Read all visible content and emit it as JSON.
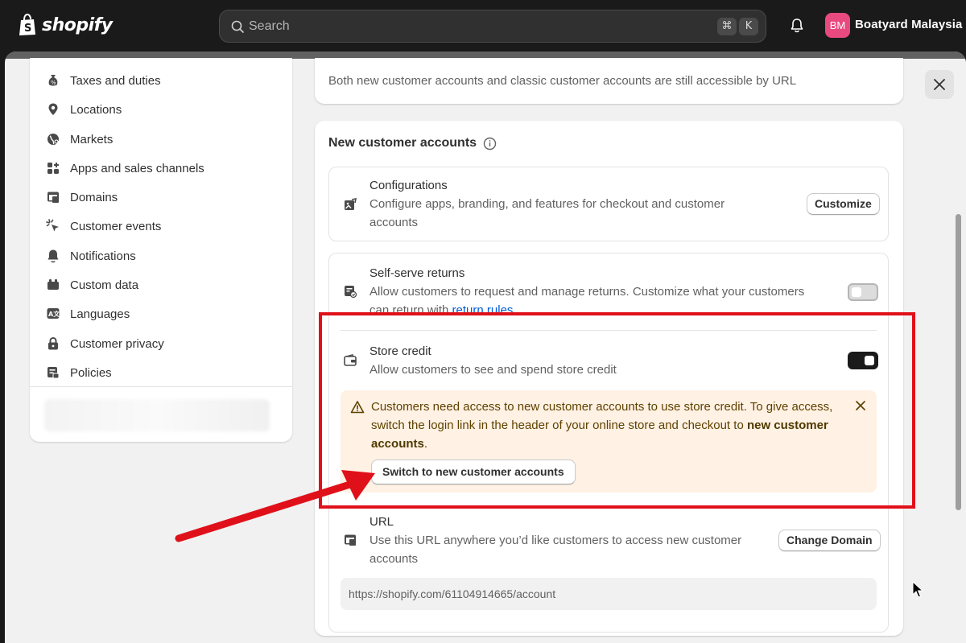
{
  "topbar": {
    "logo_text": "shopify",
    "search_placeholder": "Search",
    "kbd_cmd": "⌘",
    "kbd_k": "K",
    "avatar_initials": "BM",
    "store_name": "Boatyard Malaysia"
  },
  "sidebar": {
    "items": [
      {
        "label": "Taxes and duties",
        "icon": "taxes-icon"
      },
      {
        "label": "Locations",
        "icon": "location-pin-icon"
      },
      {
        "label": "Markets",
        "icon": "globe-icon"
      },
      {
        "label": "Apps and sales channels",
        "icon": "apps-icon"
      },
      {
        "label": "Domains",
        "icon": "domains-icon"
      },
      {
        "label": "Customer events",
        "icon": "cursor-click-icon"
      },
      {
        "label": "Notifications",
        "icon": "bell-icon"
      },
      {
        "label": "Custom data",
        "icon": "custom-data-icon"
      },
      {
        "label": "Languages",
        "icon": "language-icon"
      },
      {
        "label": "Customer privacy",
        "icon": "lock-icon"
      },
      {
        "label": "Policies",
        "icon": "policy-icon"
      }
    ]
  },
  "main": {
    "top_card_text": "Both new customer accounts and classic customer accounts are still accessible by URL",
    "section_title": "New customer accounts",
    "configurations": {
      "title": "Configurations",
      "desc_line1": "Configure apps, branding, and features for checkout and customer",
      "desc_line2": "accounts",
      "button": "Customize"
    },
    "self_serve_returns": {
      "title": "Self-serve returns",
      "desc_line1": "Allow customers to request and manage returns. Customize what your customers",
      "desc_line2_prefix": "can return with ",
      "desc_link": "return rules",
      "desc_suffix": ".",
      "enabled": false
    },
    "store_credit": {
      "title": "Store credit",
      "desc": "Allow customers to see and spend store credit",
      "enabled": true
    },
    "banner": {
      "text_part1": "Customers need access to new customer accounts to use store credit. To give access, switch the login link in the header of your online store and checkout to ",
      "text_bold": "new customer accounts",
      "text_end": ".",
      "button": "Switch to new customer accounts"
    },
    "url": {
      "title": "URL",
      "desc_line1": "Use this URL anywhere you’d like customers to access new customer",
      "desc_line2": "accounts",
      "button": "Change Domain",
      "value": "https://shopify.com/61104914665/account"
    }
  },
  "colors": {
    "topbar_bg": "#1a1a1a",
    "avatar_bg": "#e8497f",
    "banner_bg": "#fff1e3",
    "annotation_red": "#e0101a",
    "link": "#005bd3"
  }
}
